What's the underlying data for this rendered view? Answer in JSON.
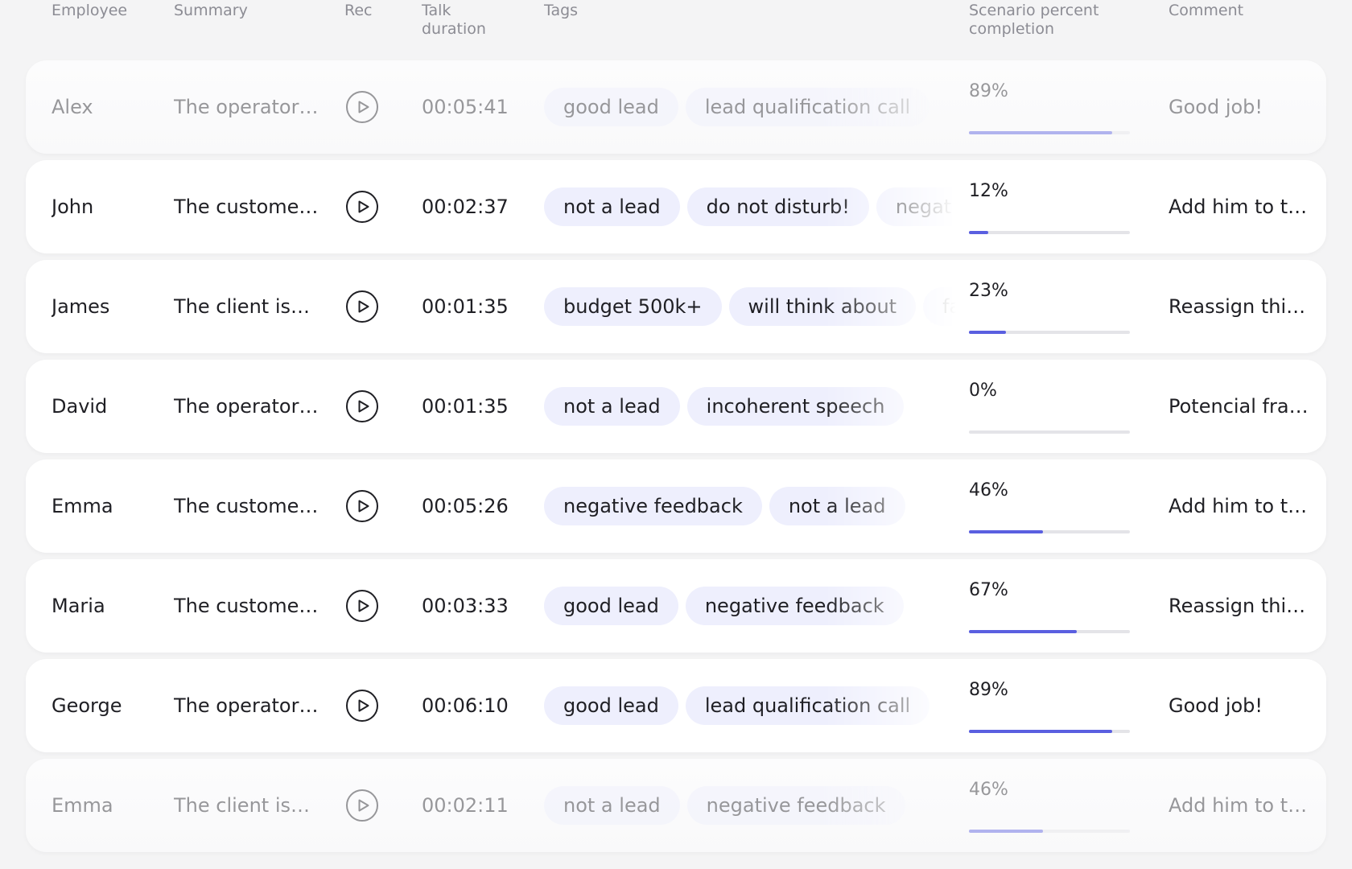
{
  "header": {
    "employee": "Employee",
    "summary": "Summary",
    "rec": "Rec",
    "talk_duration": "Talk\nduration",
    "tags": "Tags",
    "scenario": "Scenario percent\ncompletion",
    "comment": "Comment"
  },
  "colors": {
    "accent": "#5a5fe0",
    "tag_bg": "#eeeffd",
    "track": "#e4e4e8"
  },
  "rows": [
    {
      "employee": "Alex",
      "summary": "The operator…",
      "duration": "00:05:41",
      "tags": [
        "good lead",
        "lead qualification call"
      ],
      "percent": 89,
      "percent_label": "89%",
      "comment": "Good job!",
      "dim": true
    },
    {
      "employee": "John",
      "summary": "The custome…",
      "duration": "00:02:37",
      "tags": [
        "not a lead",
        "do not disturb!",
        "negat"
      ],
      "percent": 12,
      "percent_label": "12%",
      "comment": "Add him to th…",
      "dim": false
    },
    {
      "employee": "James",
      "summary": "The client is…",
      "duration": "00:01:35",
      "tags": [
        "budget 500k+",
        "will think about",
        "fa"
      ],
      "percent": 23,
      "percent_label": "23%",
      "comment": "Reassign this…",
      "dim": false
    },
    {
      "employee": "David",
      "summary": "The operator…",
      "duration": "00:01:35",
      "tags": [
        "not a lead",
        "incoherent speech"
      ],
      "percent": 0,
      "percent_label": "0%",
      "comment": "Potencial fra…",
      "dim": false
    },
    {
      "employee": "Emma",
      "summary": "The custome…",
      "duration": "00:05:26",
      "tags": [
        "negative feedback",
        "not a lead"
      ],
      "percent": 46,
      "percent_label": "46%",
      "comment": "Add him to th…",
      "dim": false
    },
    {
      "employee": "Maria",
      "summary": "The custome…",
      "duration": "00:03:33",
      "tags": [
        "good lead",
        "negative feedback"
      ],
      "percent": 67,
      "percent_label": "67%",
      "comment": "Reassign this…",
      "dim": false
    },
    {
      "employee": "George",
      "summary": "The operator…",
      "duration": "00:06:10",
      "tags": [
        "good lead",
        "lead qualification call"
      ],
      "percent": 89,
      "percent_label": "89%",
      "comment": "Good job!",
      "dim": false
    },
    {
      "employee": "Emma",
      "summary": "The client is…",
      "duration": "00:02:11",
      "tags": [
        "not a lead",
        "negative feedback"
      ],
      "percent": 46,
      "percent_label": "46%",
      "comment": "Add him to th…",
      "dim": true
    }
  ]
}
